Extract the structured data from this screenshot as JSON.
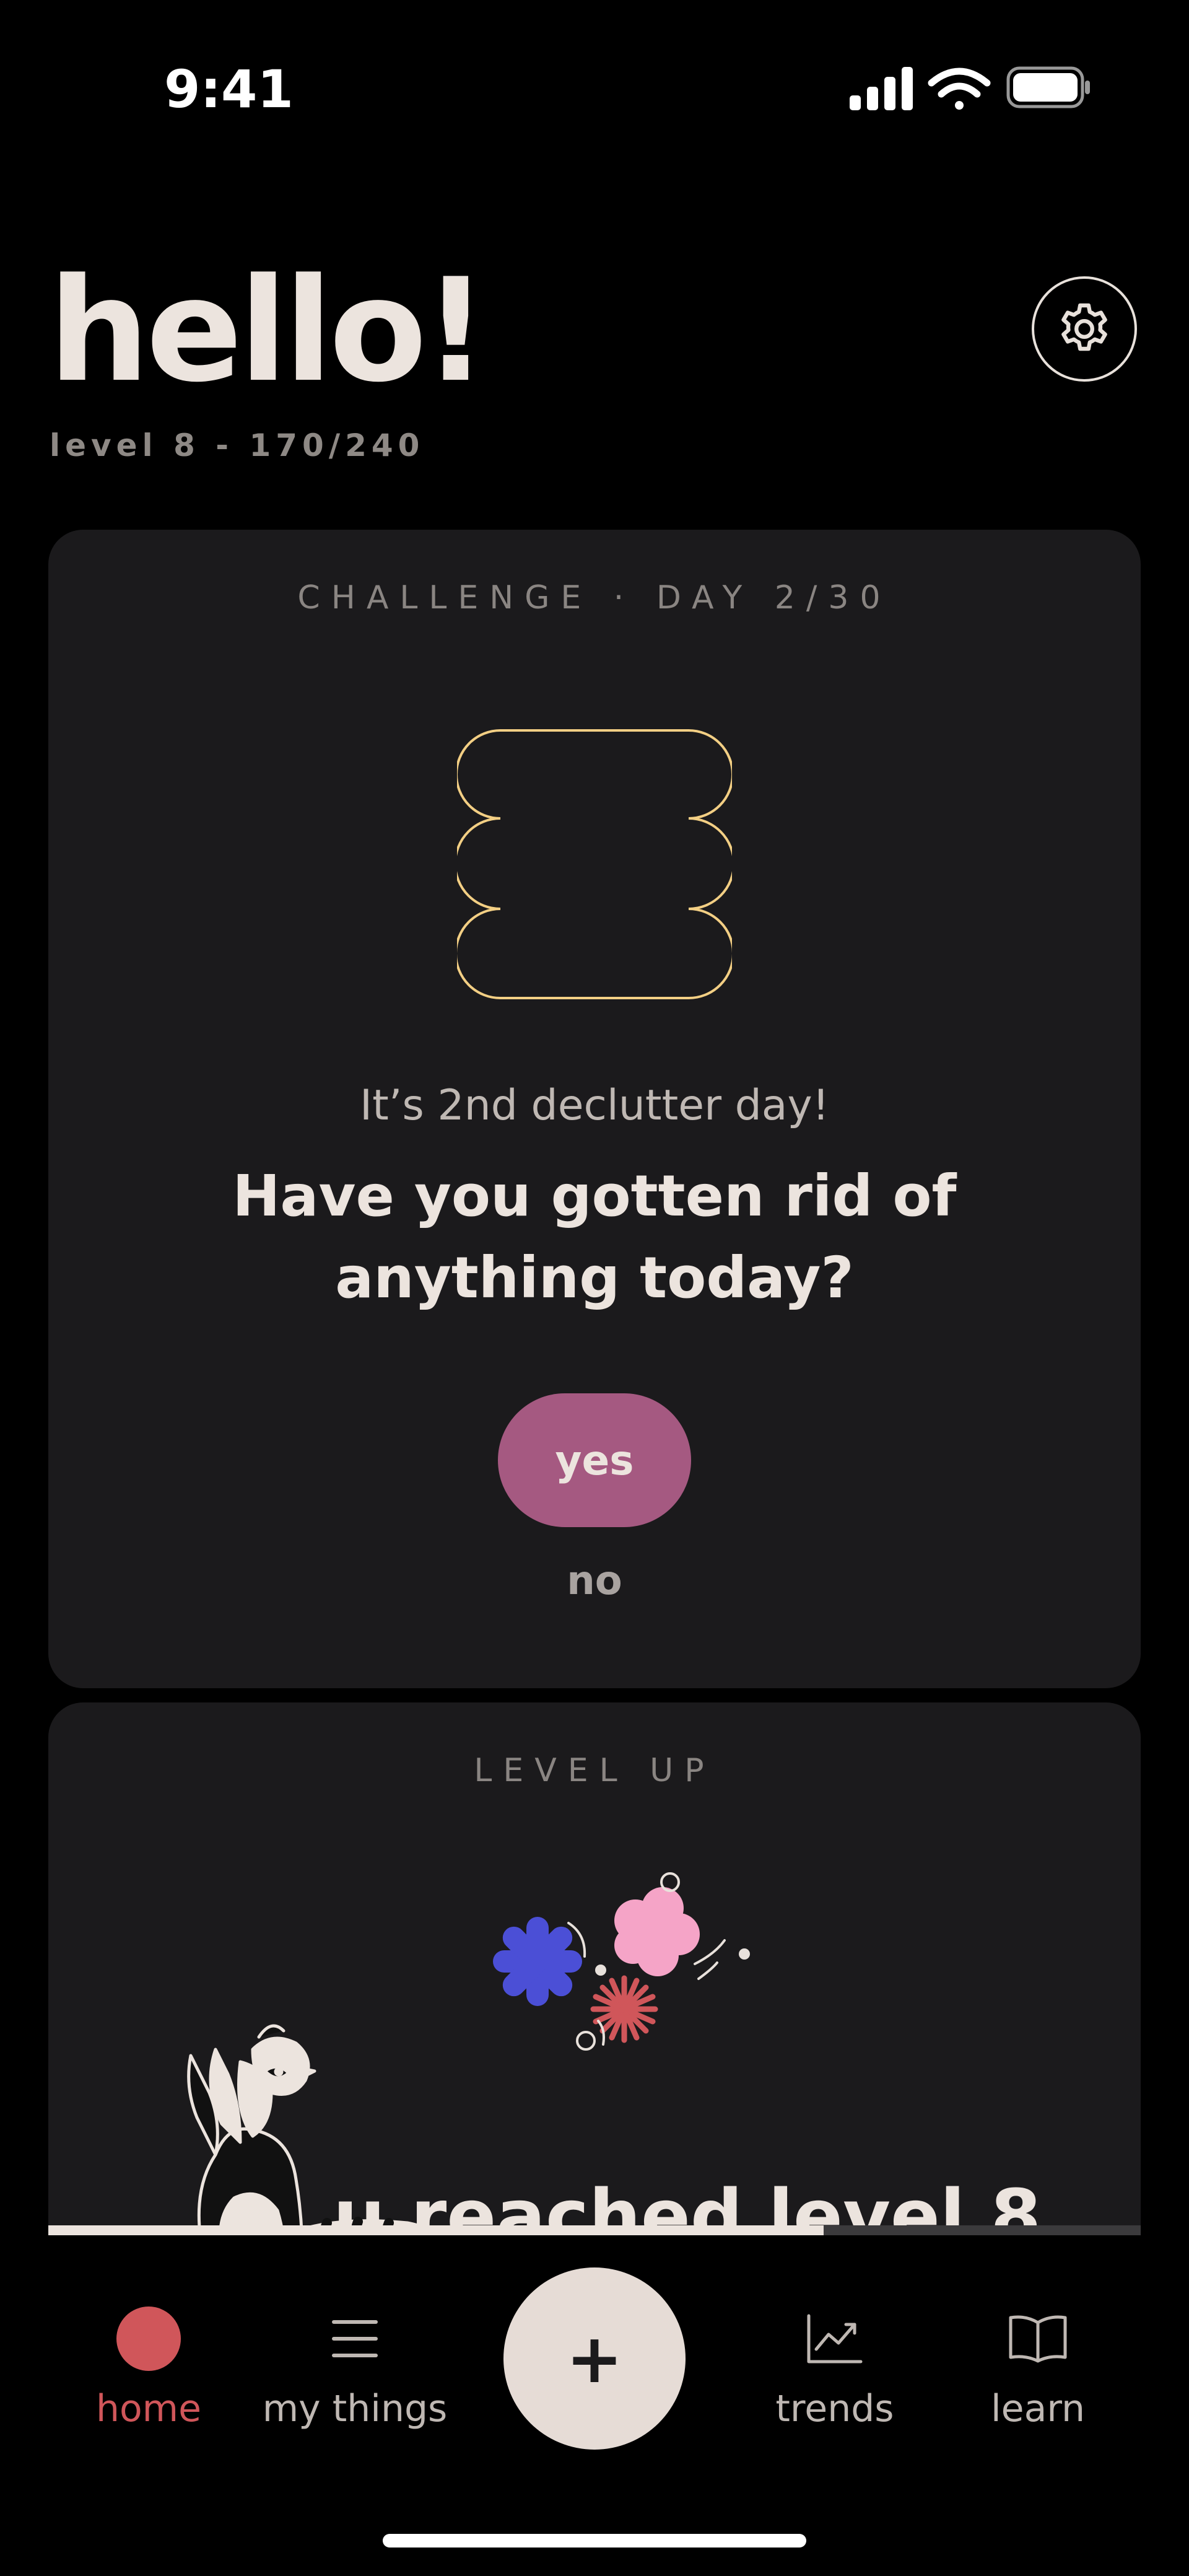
{
  "status_bar": {
    "time": "9:41"
  },
  "header": {
    "greeting": "hello!",
    "level_text": "level 8 - 170/240"
  },
  "challenge": {
    "kicker": "CHALLENGE · DAY 2/30",
    "subtitle": "It’s 2nd declutter day!",
    "question_line1": "Have you gotten rid of",
    "question_line2": "anything today?",
    "yes_label": "yes",
    "no_label": "no"
  },
  "level_up": {
    "kicker": "LEVEL UP",
    "title": "u reached level 8",
    "progress_percent": 71
  },
  "tabbar": {
    "home_label": "home",
    "things_label": "my things",
    "add_label": "+",
    "trends_label": "trends",
    "learn_label": "learn"
  },
  "colors": {
    "accent_pink": "#a55981",
    "home_red": "#d0565a",
    "shape_yellow": "#f3cf84",
    "card_bg": "#1b1a1c",
    "star_blue": "#4b4fd6",
    "star_red": "#d0565a",
    "flower_pink": "#f5a4c7"
  },
  "icons": {
    "settings": "gear-icon",
    "things": "list-icon",
    "trends": "chart-line-icon",
    "learn": "book-icon"
  }
}
